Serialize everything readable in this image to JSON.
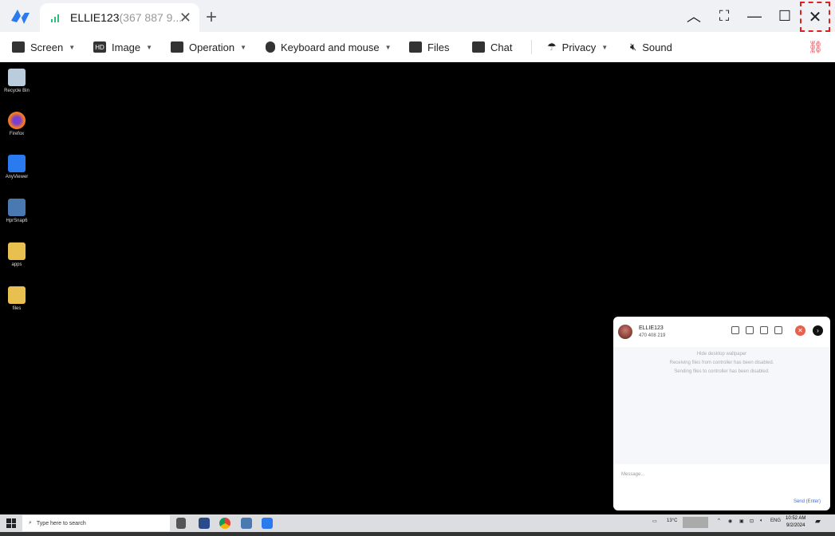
{
  "tab": {
    "name": "ELLIE123",
    "id": "(367 887 9..."
  },
  "toolbar": {
    "screen": "Screen",
    "image": "Image",
    "image_icon": "HD",
    "operation": "Operation",
    "keyboard": "Keyboard and mouse",
    "files": "Files",
    "chat": "Chat",
    "privacy": "Privacy",
    "sound": "Sound"
  },
  "desktop": [
    "Recycle Bin",
    "Firefox",
    "AnyViewer",
    "HprSnap6",
    "apps",
    "files"
  ],
  "chat": {
    "name": "ELLIE123",
    "id": "470 408 219",
    "messages": [
      "Hide desktop wallpaper",
      "Receiving files from controller has been disabled.",
      "Sending files to controller has been disabled."
    ],
    "placeholder": "Message...",
    "send": "Send (Enter)"
  },
  "taskbar": {
    "search": "Type here to search",
    "weather": "13°C",
    "lang": "ENG",
    "time": "10:52 AM",
    "date": "9/2/2024"
  }
}
